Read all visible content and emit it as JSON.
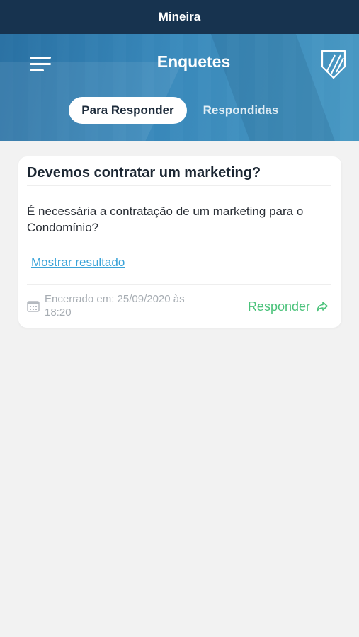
{
  "status_bar": {
    "title": "Mineira"
  },
  "header": {
    "title": "Enquetes",
    "menu_icon": "hamburger-menu-icon",
    "logo_icon": "shield-logo-icon"
  },
  "tabs": [
    {
      "label": "Para Responder",
      "active": true
    },
    {
      "label": "Respondidas",
      "active": false
    }
  ],
  "poll": {
    "title": "Devemos contratar um marketing?",
    "description": "É necessária a contratação de um marketing para o Condomínio?",
    "show_result_label": "Mostrar resultado",
    "closed_text": "Encerrado em: 25/09/2020 às 18:20",
    "respond_label": "Responder",
    "calendar_icon": "calendar-icon",
    "respond_icon": "share-arrow-icon"
  },
  "colors": {
    "status_bar": "#17334f",
    "header_blue": "#2f7fb3",
    "link_blue": "#3aa3d8",
    "respond_green": "#4ac27a",
    "background": "#f2f2f2"
  }
}
